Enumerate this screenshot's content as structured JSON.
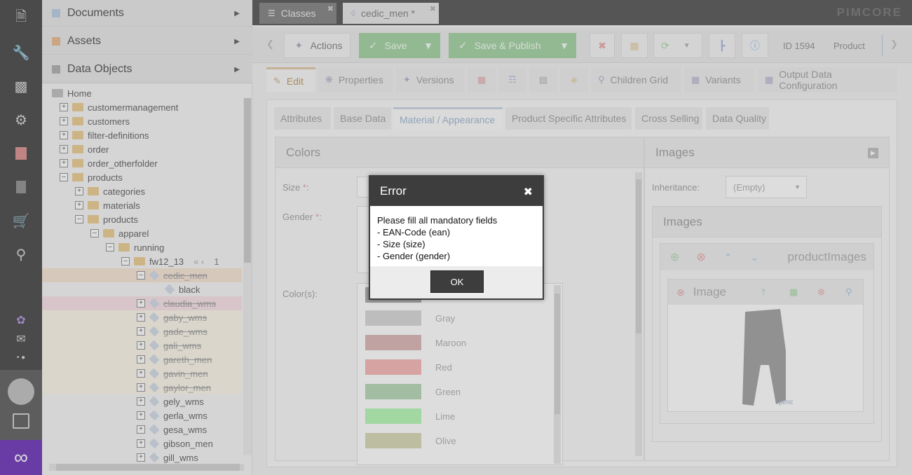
{
  "rail": {
    "icons": [
      "file-icon",
      "wrench-icon",
      "chart-icon",
      "gear-icon",
      "tag-icon",
      "pages-icon",
      "cart-icon",
      "search-icon",
      "flow-icon",
      "mail-icon"
    ]
  },
  "tree": {
    "accordion": [
      {
        "label": "Documents"
      },
      {
        "label": "Assets"
      },
      {
        "label": "Data Objects"
      }
    ],
    "rows": [
      {
        "label": "Home"
      },
      {
        "label": "customermanagement"
      },
      {
        "label": "customers"
      },
      {
        "label": "filter-definitions"
      },
      {
        "label": "order"
      },
      {
        "label": "order_otherfolder"
      },
      {
        "label": "products"
      },
      {
        "label": "categories"
      },
      {
        "label": "materials"
      },
      {
        "label": "products"
      },
      {
        "label": "apparel"
      },
      {
        "label": "running"
      },
      {
        "label": "fw12_13"
      },
      {
        "label": "cedic_men"
      },
      {
        "label": "black"
      },
      {
        "label": "claudia_wms"
      },
      {
        "label": "gaby_wms"
      },
      {
        "label": "gade_wms"
      },
      {
        "label": "gali_wms"
      },
      {
        "label": "gareth_men"
      },
      {
        "label": "gavin_men"
      },
      {
        "label": "gaylor_men"
      },
      {
        "label": "gely_wms"
      },
      {
        "label": "gerla_wms"
      },
      {
        "label": "gesa_wms"
      },
      {
        "label": "gibson_men"
      },
      {
        "label": "gill_wms"
      }
    ],
    "pager": "1"
  },
  "tabs": [
    {
      "label": "Classes"
    },
    {
      "label": "cedic_men *"
    }
  ],
  "brand": "PIMCORE",
  "toolbar": {
    "actions": "Actions",
    "save": "Save",
    "save_publish": "Save & Publish",
    "id": "ID 1594",
    "type": "Product"
  },
  "edit_tabs": [
    {
      "label": "Edit"
    },
    {
      "label": "Properties"
    },
    {
      "label": "Versions"
    },
    {
      "label": "Children Grid"
    },
    {
      "label": "Variants"
    },
    {
      "label": "Output Data Configuration"
    }
  ],
  "sub_tabs": [
    {
      "label": "Attributes"
    },
    {
      "label": "Base Data"
    },
    {
      "label": "Material / Appearance"
    },
    {
      "label": "Product Specific Attributes"
    },
    {
      "label": "Cross Selling"
    },
    {
      "label": "Data Quality"
    }
  ],
  "colors_panel": {
    "title": "Colors",
    "size_label": "Size",
    "gender_label": "Gender",
    "required": "*",
    "colon": ":",
    "colors_label": "Color(s):",
    "colors": [
      {
        "name": "Gray",
        "hex": "#d4d4d4"
      },
      {
        "name": "Maroon",
        "hex": "#d9b1b1"
      },
      {
        "name": "Red",
        "hex": "#f7b1b1"
      },
      {
        "name": "Green",
        "hex": "#b1d4b1"
      },
      {
        "name": "Lime",
        "hex": "#b1f7b1"
      },
      {
        "name": "Olive",
        "hex": "#d4d4b1"
      }
    ]
  },
  "images_panel": {
    "title": "Images",
    "inheritance_label": "Inheritance:",
    "inheritance_value": "(Empty)",
    "images_title": "Images",
    "product_images": "productImages",
    "image_label": "Image",
    "watermark": "pimcore"
  },
  "modal": {
    "title": "Error",
    "lines": [
      "Please fill all mandatory fields",
      "- EAN-Code (ean)",
      "- Size (size)",
      "- Gender (gender)"
    ],
    "ok": "OK"
  }
}
